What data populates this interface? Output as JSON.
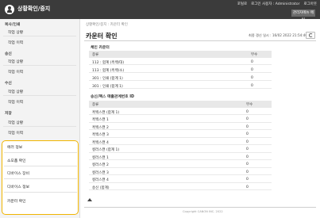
{
  "header": {
    "app_title": "상황확인/중지",
    "links": [
      "포털로",
      "로그인 사용자 : Administrator",
      "로그아웃"
    ],
    "admin_button": "관리자메뉴 메일"
  },
  "sidebar": {
    "sections": [
      {
        "title": "복사/인쇄",
        "items": [
          "작업 상황",
          "작업 이력"
        ]
      },
      {
        "title": "송신",
        "items": [
          "작업 상황",
          "작업 이력"
        ]
      },
      {
        "title": "수신",
        "items": [
          "작업 상황",
          "작업 이력"
        ]
      },
      {
        "title": "저장",
        "items": [
          "작업 상황",
          "작업 이력"
        ]
      }
    ],
    "highlighted_items": [
      "에러 정보",
      "소모품 확인",
      "디바이스 장비",
      "디바이스 정보",
      "카운터 확인"
    ]
  },
  "main": {
    "breadcrumb": "상황확인/중지 : 카운터 확인",
    "title": "카운터 확인",
    "refresh_label": "최종 갱신 일시 : 16/02 2022 21:54:40",
    "section1": {
      "title": "체인 카운터",
      "headers": [
        "종류",
        "부수"
      ],
      "rows": [
        [
          "112 : 합계 (흑백/대)",
          "0"
        ],
        [
          "113 : 합계 (흑백/소)",
          "0"
        ],
        [
          "301 : 인쇄 (합계 1)",
          "0"
        ],
        [
          "301 : 인쇄 (합계 1)",
          "0"
        ]
      ]
    },
    "section2": {
      "title": "송신/팩스 매출관계번호 ID",
      "headers": [
        "종류",
        "부수"
      ],
      "rows": [
        [
          "흑백스캔 (합계 1)",
          "0"
        ],
        [
          "흑백스캔 1",
          "0"
        ],
        [
          "흑백스캔 2",
          "0"
        ],
        [
          "흑백스캔 3",
          "0"
        ],
        [
          "흑백스캔 4",
          "0"
        ],
        [
          "컬러스캔 (합계 1)",
          "0"
        ],
        [
          "컬러스캔 1",
          "0"
        ],
        [
          "컬러스캔 2",
          "0"
        ],
        [
          "컬러스캔 3",
          "0"
        ],
        [
          "컬러스캔 4",
          "0"
        ],
        [
          "송신 (합계)",
          "0"
        ]
      ]
    },
    "copyright": "Copyright CANON INC. 2022"
  },
  "colors": {
    "topbar": "#3b3b3b",
    "highlight_border": "#f0b400",
    "sidebar_bg": "#f3f3f3"
  }
}
